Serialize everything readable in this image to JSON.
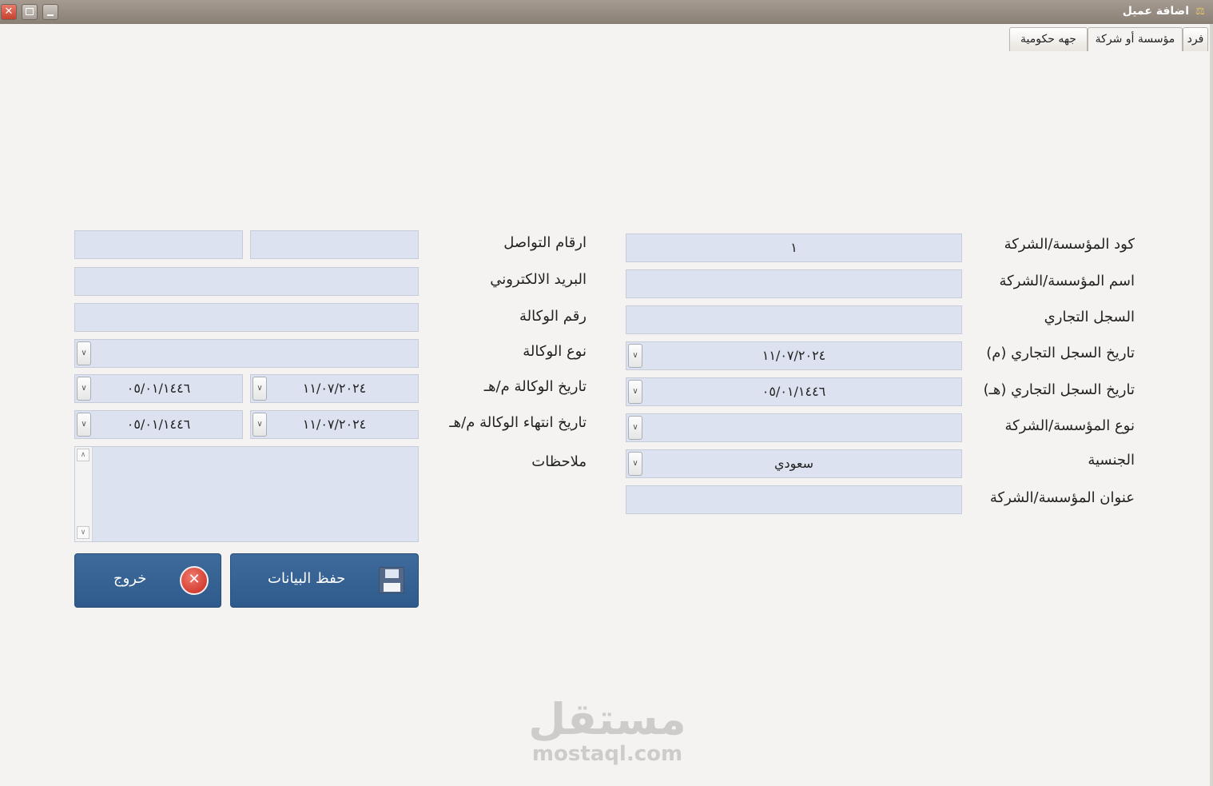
{
  "window": {
    "title": "اضافة عميل",
    "close_glyph": "✕"
  },
  "tabs": [
    "فرد",
    "مؤسسة أو شركة",
    "جهه حكومية"
  ],
  "right_form": {
    "code_label": "كود المؤسسة/الشركة",
    "code_value": "١",
    "name_label": "اسم المؤسسة/الشركة",
    "name_value": "",
    "cr_label": "السجل التجاري",
    "cr_value": "",
    "cr_date_g_label": "تاريخ السجل التجاري (م)",
    "cr_date_g_value": "١١/٠٧/٢٠٢٤",
    "cr_date_h_label": "تاريخ السجل التجاري (هـ)",
    "cr_date_h_value": "٠٥/٠١/١٤٤٦",
    "type_label": "نوع المؤسسة/الشركة",
    "type_value": "",
    "nationality_label": "الجنسية",
    "nationality_value": "سعودي",
    "address_label": "عنوان المؤسسة/الشركة",
    "address_value": ""
  },
  "left_form": {
    "contacts_label": "ارقام التواصل",
    "contact1_value": "",
    "contact2_value": "",
    "email_label": "البريد الالكتروني",
    "email_value": "",
    "poa_number_label": "رقم الوكالة",
    "poa_number_value": "",
    "poa_type_label": "نوع الوكالة",
    "poa_type_value": "",
    "poa_date_label": "تاريخ الوكالة م/هـ",
    "poa_date_g_value": "١١/٠٧/٢٠٢٤",
    "poa_date_h_value": "٠٥/٠١/١٤٤٦",
    "poa_end_label": "تاريخ انتهاء الوكالة م/هـ",
    "poa_end_g_value": "١١/٠٧/٢٠٢٤",
    "poa_end_h_value": "٠٥/٠١/١٤٤٦",
    "notes_label": "ملاحظات"
  },
  "buttons": {
    "save_label": "حفظ البيانات",
    "exit_label": "خروج"
  },
  "watermark": {
    "arabic": "مستقل",
    "latin": "mostaql.com"
  }
}
